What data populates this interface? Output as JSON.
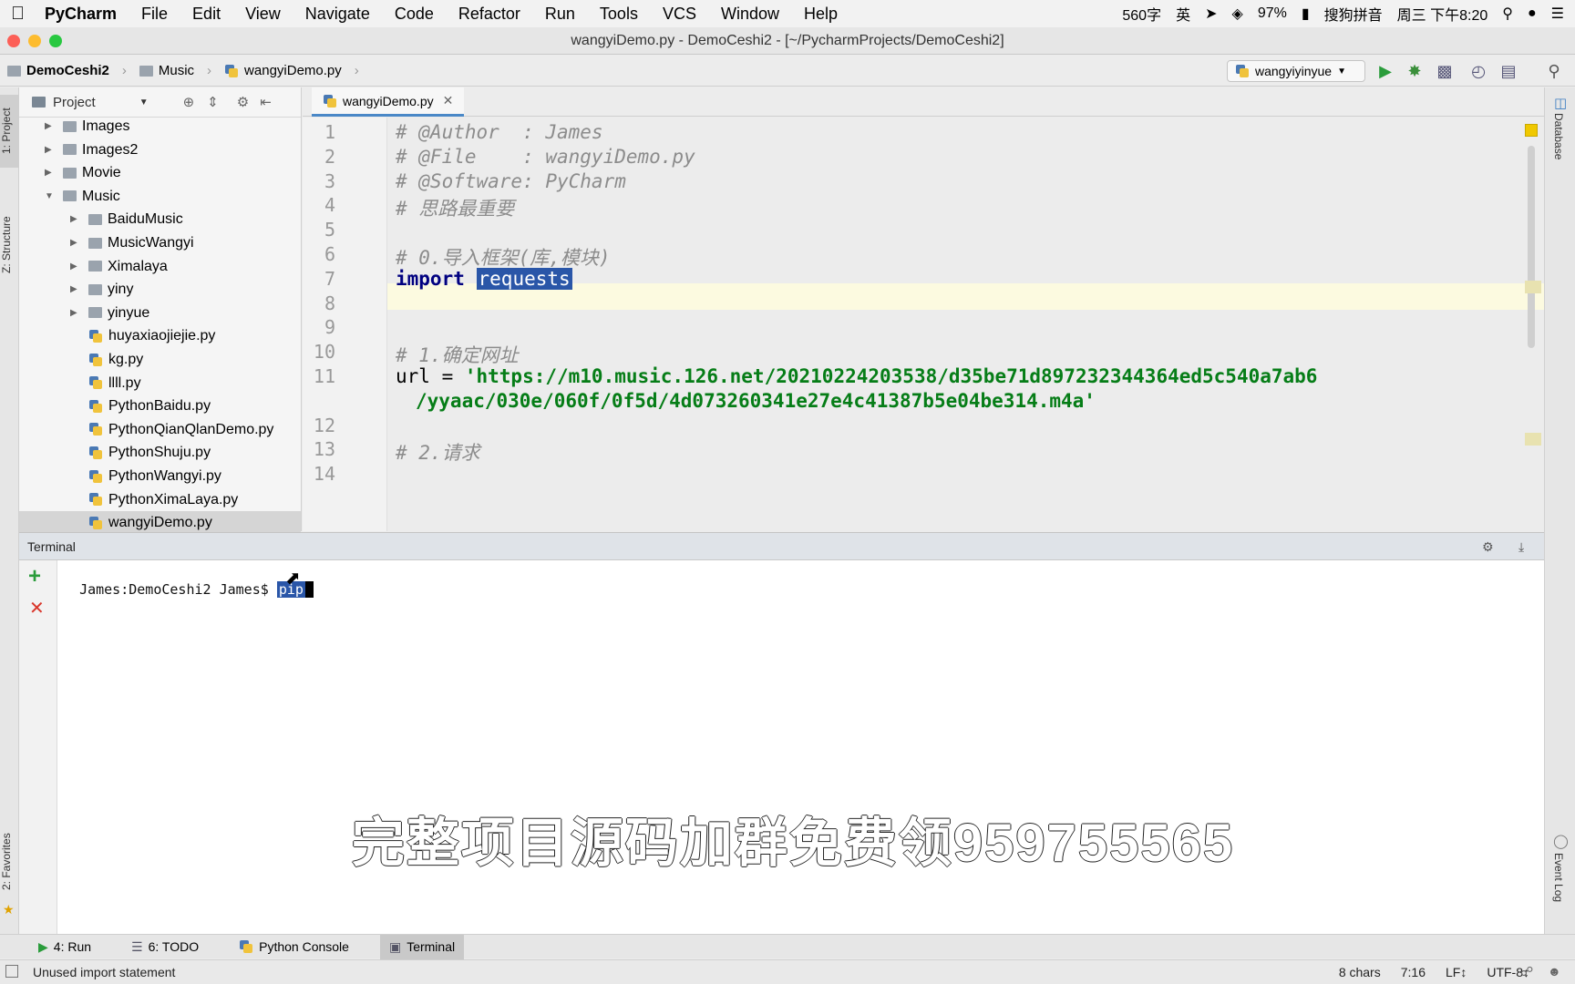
{
  "menubar": {
    "app": "PyCharm",
    "items": [
      "File",
      "Edit",
      "View",
      "Navigate",
      "Code",
      "Refactor",
      "Run",
      "Tools",
      "VCS",
      "Window",
      "Help"
    ],
    "status": {
      "word_count": "560字",
      "ime": "英",
      "battery": "97%",
      "ime_name": "搜狗拼音",
      "clock": "周三 下午8:20"
    }
  },
  "window": {
    "title": "wangyiDemo.py - DemoCeshi2 - [~/PycharmProjects/DemoCeshi2]"
  },
  "breadcrumb": {
    "project": "DemoCeshi2",
    "folder": "Music",
    "file": "wangyiDemo.py"
  },
  "run_config": {
    "name": "wangyiyinyue"
  },
  "left_stripe": {
    "project": "1: Project",
    "structure": "Z: Structure",
    "favorites": "2: Favorites"
  },
  "right_stripe": {
    "database": "Database",
    "event_log": "Event Log"
  },
  "project_panel": {
    "title": "Project",
    "tree": [
      {
        "label": "Images",
        "type": "folder",
        "level": 1,
        "expanded": false
      },
      {
        "label": "Images2",
        "type": "folder",
        "level": 1,
        "expanded": false
      },
      {
        "label": "Movie",
        "type": "folder",
        "level": 1,
        "expanded": false
      },
      {
        "label": "Music",
        "type": "folder",
        "level": 1,
        "expanded": true
      },
      {
        "label": "BaiduMusic",
        "type": "folder",
        "level": 2,
        "expanded": false
      },
      {
        "label": "MusicWangyi",
        "type": "folder",
        "level": 2,
        "expanded": false
      },
      {
        "label": "Ximalaya",
        "type": "folder",
        "level": 2,
        "expanded": false
      },
      {
        "label": "yiny",
        "type": "folder",
        "level": 2,
        "expanded": false
      },
      {
        "label": "yinyue",
        "type": "folder",
        "level": 2,
        "expanded": false
      },
      {
        "label": "huyaxiaojiejie.py",
        "type": "file",
        "level": 2
      },
      {
        "label": "kg.py",
        "type": "file",
        "level": 2
      },
      {
        "label": "llll.py",
        "type": "file",
        "level": 2
      },
      {
        "label": "PythonBaidu.py",
        "type": "file",
        "level": 2
      },
      {
        "label": "PythonQianQlanDemo.py",
        "type": "file",
        "level": 2
      },
      {
        "label": "PythonShuju.py",
        "type": "file",
        "level": 2
      },
      {
        "label": "PythonWangyi.py",
        "type": "file",
        "level": 2
      },
      {
        "label": "PythonXimaLaya.py",
        "type": "file",
        "level": 2
      },
      {
        "label": "wangyiDemo.py",
        "type": "file",
        "level": 2,
        "selected": true
      }
    ]
  },
  "editor": {
    "tab": "wangyiDemo.py",
    "lines": [
      {
        "n": "1",
        "text": "# @Author  : James",
        "kind": "comment"
      },
      {
        "n": "2",
        "text": "# @File    : wangyiDemo.py",
        "kind": "comment"
      },
      {
        "n": "3",
        "text": "# @Software: PyCharm",
        "kind": "comment"
      },
      {
        "n": "4",
        "text": "# 思路最重要",
        "kind": "comment"
      },
      {
        "n": "5",
        "text": "",
        "kind": "plain"
      },
      {
        "n": "6",
        "text": "# 0.导入框架(库,模块)",
        "kind": "comment"
      },
      {
        "n": "7",
        "text": "",
        "kind": "import",
        "keyword": "import",
        "module": "requests"
      },
      {
        "n": "8",
        "text": "",
        "kind": "plain"
      },
      {
        "n": "9",
        "text": "",
        "kind": "plain"
      },
      {
        "n": "10",
        "text": "# 1.确定网址",
        "kind": "comment"
      },
      {
        "n": "11",
        "text": "",
        "kind": "assign",
        "var": "url = ",
        "value": "'https://m10.music.126.net/20210224203538/d35be71d897232344364ed5c540a7ab6",
        "cont": "/yyaac/030e/060f/0f5d/4d073260341e27e4c41387b5e04be314.m4a'"
      },
      {
        "n": "12",
        "text": "",
        "kind": "plain"
      },
      {
        "n": "13",
        "text": "# 2.请求",
        "kind": "comment"
      },
      {
        "n": "14",
        "text": "",
        "kind": "plain"
      }
    ]
  },
  "terminal": {
    "title": "Terminal",
    "prompt": "James:DemoCeshi2 James$ ",
    "input": "pip"
  },
  "watermark": "完整项目源码加群免费领959755565",
  "tool_windows": [
    {
      "label": "4: Run",
      "icon": "play-icon"
    },
    {
      "label": "6: TODO",
      "icon": "todo-icon"
    },
    {
      "label": "Python Console",
      "icon": "python-console-icon"
    },
    {
      "label": "Terminal",
      "icon": "terminal-icon",
      "active": true
    }
  ],
  "statusbar": {
    "message": "Unused import statement",
    "chars": "8 chars",
    "position": "7:16",
    "line_sep": "LF↕",
    "encoding": "UTF-8↕"
  },
  "colors": {
    "accent": "#4a88c7",
    "selection": "#2a56a8",
    "keyword": "#000080",
    "string": "#067d17",
    "comment": "#8c8c8c"
  }
}
